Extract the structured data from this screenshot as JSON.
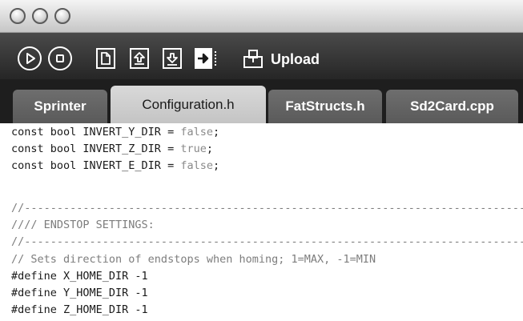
{
  "toolbar": {
    "upload_label": "Upload"
  },
  "tabs": [
    {
      "label": "Sprinter"
    },
    {
      "label": "Configuration.h"
    },
    {
      "label": "FatStructs.h"
    },
    {
      "label": "Sd2Card.cpp"
    }
  ],
  "code": {
    "lines": [
      {
        "pre": "const bool INVERT_Y_DIR = ",
        "lit": "false",
        "post": ";"
      },
      {
        "pre": "const bool INVERT_Z_DIR = ",
        "lit": "true",
        "post": ";"
      },
      {
        "pre": "const bool INVERT_E_DIR = ",
        "lit": "false",
        "post": ";"
      },
      {
        "text": ""
      },
      {
        "comment": "//--------------------------------------------------------------------------------"
      },
      {
        "comment": "//// ENDSTOP SETTINGS:"
      },
      {
        "comment": "//--------------------------------------------------------------------------------"
      },
      {
        "comment": "// Sets direction of endstops when homing; 1=MAX, -1=MIN"
      },
      {
        "text": "#define X_HOME_DIR -1"
      },
      {
        "text": "#define Y_HOME_DIR -1"
      },
      {
        "text": "#define Z_HOME_DIR -1"
      }
    ]
  },
  "colors": {
    "toolbar_bg": "#333333",
    "tab_inactive": "#666666",
    "tab_active": "#cfcfcf",
    "literal": "#8a8a8a",
    "comment": "#7d7d7d"
  }
}
